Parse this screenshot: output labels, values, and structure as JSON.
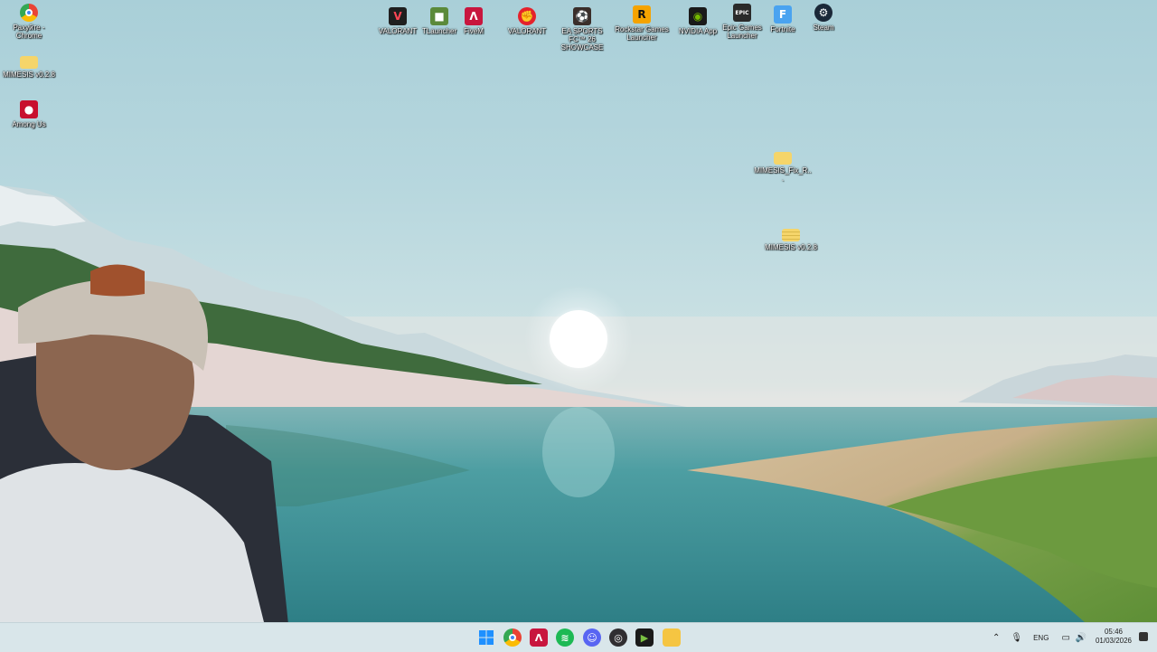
{
  "desktop_icons_left": [
    {
      "label": "Рахуйте - Chrome",
      "icon": "chrome-icon"
    },
    {
      "label": "MIMESIS v0.2.8",
      "icon": "folder-icon"
    },
    {
      "label": "Among Us",
      "icon": "among-us-icon"
    }
  ],
  "desktop_icons_top": [
    {
      "label": "VALORANT",
      "icon": "valorant-icon"
    },
    {
      "label": "TLauncher",
      "icon": "tlauncher-icon"
    },
    {
      "label": "FiveM",
      "icon": "fivem-icon"
    },
    {
      "label": "VALORANT",
      "icon": "riot-client-icon"
    },
    {
      "label": "EA SPORTS FC™ 26 SHOWCASE",
      "icon": "ea-fc-icon"
    },
    {
      "label": "Rockstar Games Launcher",
      "icon": "rockstar-icon"
    },
    {
      "label": "NVIDIA App",
      "icon": "nvidia-icon"
    },
    {
      "label": "Epic Games Launcher",
      "icon": "epic-games-icon"
    },
    {
      "label": "Fortnite",
      "icon": "fortnite-icon"
    },
    {
      "label": "Steam",
      "icon": "steam-icon"
    }
  ],
  "desktop_icons_right": [
    {
      "label": "MIMESIS_Fix_R...",
      "icon": "folder-icon"
    },
    {
      "label": "MIMESIS v0.2.8",
      "icon": "folder-zip-icon"
    }
  ],
  "taskbar": {
    "apps": [
      "start-icon",
      "chrome-icon",
      "fivem-icon",
      "spotify-icon",
      "discord-icon",
      "obs-icon",
      "xbox-icon",
      "file-explorer-icon"
    ],
    "tray": {
      "language": "ENG"
    },
    "clock": {
      "time": "05:46",
      "date": "01/03/2026"
    }
  },
  "colors": {
    "taskbar_bg": "#d9e6ea",
    "sky": "#a9cfd8",
    "water": "#3f8f94"
  }
}
